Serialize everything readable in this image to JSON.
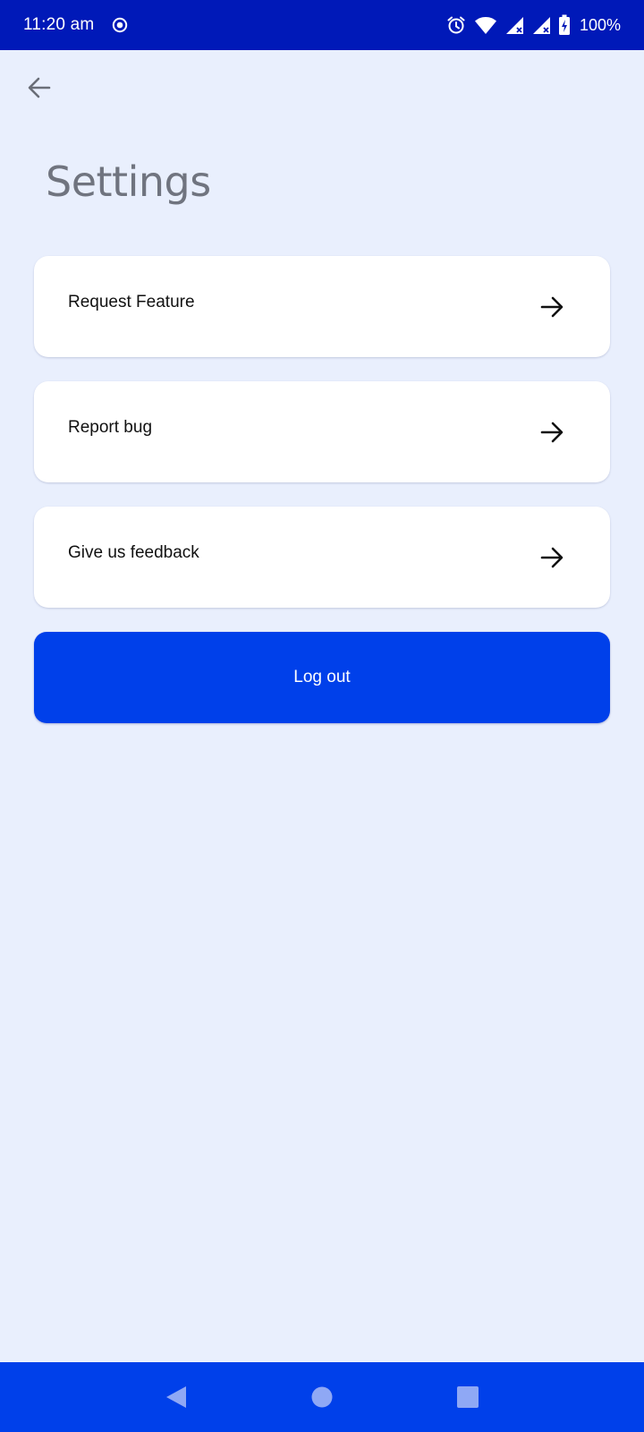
{
  "status_bar": {
    "time": "11:20 am",
    "battery_text": "100%",
    "icons": [
      "record-icon",
      "alarm-icon",
      "wifi-icon",
      "signal-icon",
      "signal-icon",
      "battery-charging-icon"
    ]
  },
  "header": {
    "back_icon": "arrow-left-icon",
    "title": "Settings"
  },
  "settings": {
    "items": [
      {
        "label": "Request Feature",
        "icon": "arrow-right-icon"
      },
      {
        "label": "Report bug",
        "icon": "arrow-right-icon"
      },
      {
        "label": "Give us feedback",
        "icon": "arrow-right-icon"
      }
    ]
  },
  "logout": {
    "label": "Log out"
  },
  "nav_bar": {
    "buttons": [
      "back-triangle-icon",
      "home-circle-icon",
      "recents-square-icon"
    ]
  },
  "colors": {
    "background": "#e9effd",
    "status_bar": "#0019b8",
    "accent": "#0040ea",
    "card": "#ffffff",
    "title_text": "#70747f"
  }
}
